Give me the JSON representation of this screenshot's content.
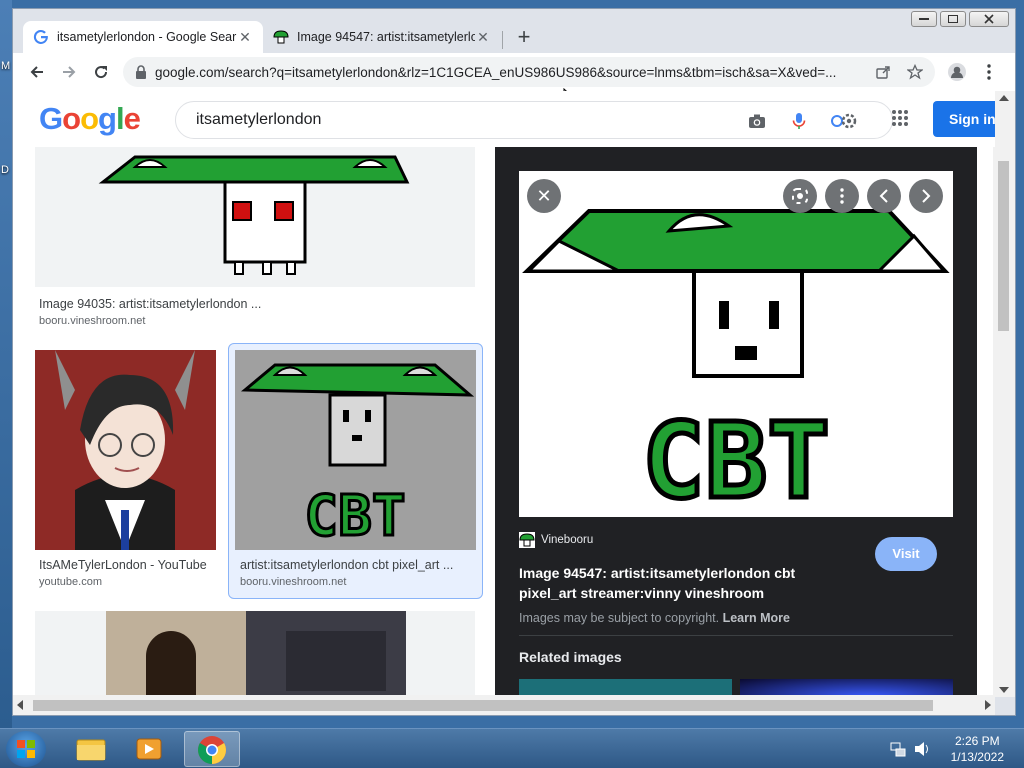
{
  "desktop": {
    "edge_letters": [
      "M",
      "D"
    ]
  },
  "browser": {
    "tabs": [
      {
        "title": "itsametylerlondon - Google Sear",
        "active": true
      },
      {
        "title": "Image 94547: artist:itsametylerlor",
        "active": false
      }
    ],
    "url": "google.com/search?q=itsametylerlondon&rlz=1C1GCEA_enUS986US986&source=lnms&tbm=isch&sa=X&ved=..."
  },
  "google": {
    "logo_letters": [
      "G",
      "o",
      "o",
      "g",
      "l",
      "e"
    ],
    "logo_colors": [
      "#4285F4",
      "#EA4335",
      "#FBBC05",
      "#4285F4",
      "#34A853",
      "#EA4335"
    ],
    "query": "itsametylerlondon",
    "sign_in_label": "Sign in"
  },
  "results": [
    {
      "title": "Image 94035: artist:itsametylerlondon ...",
      "source": "booru.vineshroom.net"
    },
    {
      "title": "ItsAMeTylerLondon - YouTube",
      "source": "youtube.com"
    },
    {
      "title": "artist:itsametylerlondon cbt pixel_art ...",
      "source": "booru.vineshroom.net"
    }
  ],
  "panel": {
    "image_text": "CBT",
    "site_name": "Vinebooru",
    "title": "Image 94547: artist:itsametylerlondon cbt pixel_art streamer:vinny vineshroom",
    "visit_label": "Visit",
    "copyright_text": "Images may be subject to copyright.",
    "learn_more": "Learn More",
    "related_heading": "Related images"
  },
  "taskbar": {
    "time": "2:26 PM",
    "date": "1/13/2022"
  },
  "colors": {
    "accent": "#1a73e8",
    "mushroom_green": "#22a033",
    "panel_bg": "#202124"
  }
}
